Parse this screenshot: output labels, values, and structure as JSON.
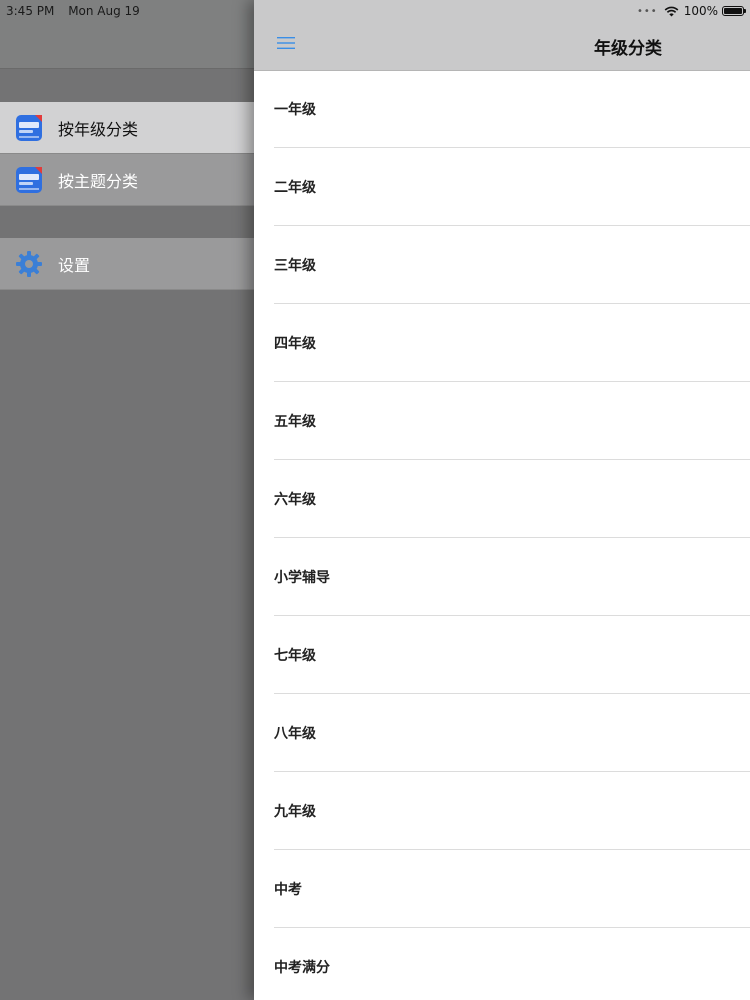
{
  "status_bar": {
    "time": "3:45 PM",
    "date": "Mon Aug 19",
    "battery_percent": "100%",
    "battery_level": 1.0
  },
  "side_menu": {
    "items": [
      {
        "label": "按年级分类",
        "icon": "book-app-icon",
        "selected": true
      },
      {
        "label": "按主题分类",
        "icon": "book-app-icon",
        "selected": false
      }
    ],
    "settings": {
      "label": "设置",
      "icon": "gear-icon"
    }
  },
  "nav": {
    "title": "年级分类",
    "menu_icon": "hamburger-menu-icon"
  },
  "grades": [
    "一年级",
    "二年级",
    "三年级",
    "四年级",
    "五年级",
    "六年级",
    "小学辅导",
    "七年级",
    "八年级",
    "九年级",
    "中考",
    "中考满分"
  ],
  "colors": {
    "accent": "#3a8ee6",
    "app_icon_blue": "#2f6fe0",
    "app_icon_badge": "#e23b3b"
  }
}
